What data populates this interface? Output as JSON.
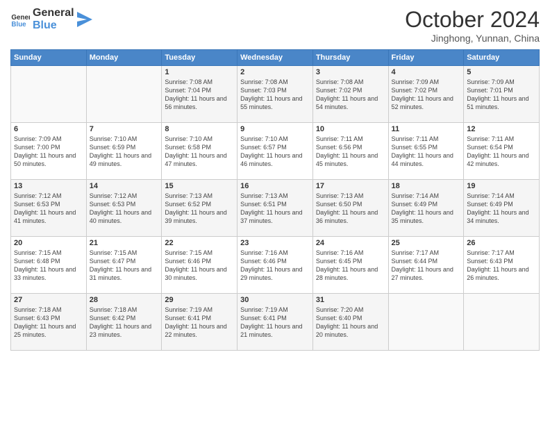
{
  "logo": {
    "line1": "General",
    "line2": "Blue"
  },
  "title": "October 2024",
  "location": "Jinghong, Yunnan, China",
  "weekdays": [
    "Sunday",
    "Monday",
    "Tuesday",
    "Wednesday",
    "Thursday",
    "Friday",
    "Saturday"
  ],
  "weeks": [
    [
      {
        "day": "",
        "info": ""
      },
      {
        "day": "",
        "info": ""
      },
      {
        "day": "1",
        "info": "Sunrise: 7:08 AM\nSunset: 7:04 PM\nDaylight: 11 hours and 56 minutes."
      },
      {
        "day": "2",
        "info": "Sunrise: 7:08 AM\nSunset: 7:03 PM\nDaylight: 11 hours and 55 minutes."
      },
      {
        "day": "3",
        "info": "Sunrise: 7:08 AM\nSunset: 7:02 PM\nDaylight: 11 hours and 54 minutes."
      },
      {
        "day": "4",
        "info": "Sunrise: 7:09 AM\nSunset: 7:02 PM\nDaylight: 11 hours and 52 minutes."
      },
      {
        "day": "5",
        "info": "Sunrise: 7:09 AM\nSunset: 7:01 PM\nDaylight: 11 hours and 51 minutes."
      }
    ],
    [
      {
        "day": "6",
        "info": "Sunrise: 7:09 AM\nSunset: 7:00 PM\nDaylight: 11 hours and 50 minutes."
      },
      {
        "day": "7",
        "info": "Sunrise: 7:10 AM\nSunset: 6:59 PM\nDaylight: 11 hours and 49 minutes."
      },
      {
        "day": "8",
        "info": "Sunrise: 7:10 AM\nSunset: 6:58 PM\nDaylight: 11 hours and 47 minutes."
      },
      {
        "day": "9",
        "info": "Sunrise: 7:10 AM\nSunset: 6:57 PM\nDaylight: 11 hours and 46 minutes."
      },
      {
        "day": "10",
        "info": "Sunrise: 7:11 AM\nSunset: 6:56 PM\nDaylight: 11 hours and 45 minutes."
      },
      {
        "day": "11",
        "info": "Sunrise: 7:11 AM\nSunset: 6:55 PM\nDaylight: 11 hours and 44 minutes."
      },
      {
        "day": "12",
        "info": "Sunrise: 7:11 AM\nSunset: 6:54 PM\nDaylight: 11 hours and 42 minutes."
      }
    ],
    [
      {
        "day": "13",
        "info": "Sunrise: 7:12 AM\nSunset: 6:53 PM\nDaylight: 11 hours and 41 minutes."
      },
      {
        "day": "14",
        "info": "Sunrise: 7:12 AM\nSunset: 6:53 PM\nDaylight: 11 hours and 40 minutes."
      },
      {
        "day": "15",
        "info": "Sunrise: 7:13 AM\nSunset: 6:52 PM\nDaylight: 11 hours and 39 minutes."
      },
      {
        "day": "16",
        "info": "Sunrise: 7:13 AM\nSunset: 6:51 PM\nDaylight: 11 hours and 37 minutes."
      },
      {
        "day": "17",
        "info": "Sunrise: 7:13 AM\nSunset: 6:50 PM\nDaylight: 11 hours and 36 minutes."
      },
      {
        "day": "18",
        "info": "Sunrise: 7:14 AM\nSunset: 6:49 PM\nDaylight: 11 hours and 35 minutes."
      },
      {
        "day": "19",
        "info": "Sunrise: 7:14 AM\nSunset: 6:49 PM\nDaylight: 11 hours and 34 minutes."
      }
    ],
    [
      {
        "day": "20",
        "info": "Sunrise: 7:15 AM\nSunset: 6:48 PM\nDaylight: 11 hours and 33 minutes."
      },
      {
        "day": "21",
        "info": "Sunrise: 7:15 AM\nSunset: 6:47 PM\nDaylight: 11 hours and 31 minutes."
      },
      {
        "day": "22",
        "info": "Sunrise: 7:15 AM\nSunset: 6:46 PM\nDaylight: 11 hours and 30 minutes."
      },
      {
        "day": "23",
        "info": "Sunrise: 7:16 AM\nSunset: 6:46 PM\nDaylight: 11 hours and 29 minutes."
      },
      {
        "day": "24",
        "info": "Sunrise: 7:16 AM\nSunset: 6:45 PM\nDaylight: 11 hours and 28 minutes."
      },
      {
        "day": "25",
        "info": "Sunrise: 7:17 AM\nSunset: 6:44 PM\nDaylight: 11 hours and 27 minutes."
      },
      {
        "day": "26",
        "info": "Sunrise: 7:17 AM\nSunset: 6:43 PM\nDaylight: 11 hours and 26 minutes."
      }
    ],
    [
      {
        "day": "27",
        "info": "Sunrise: 7:18 AM\nSunset: 6:43 PM\nDaylight: 11 hours and 25 minutes."
      },
      {
        "day": "28",
        "info": "Sunrise: 7:18 AM\nSunset: 6:42 PM\nDaylight: 11 hours and 23 minutes."
      },
      {
        "day": "29",
        "info": "Sunrise: 7:19 AM\nSunset: 6:41 PM\nDaylight: 11 hours and 22 minutes."
      },
      {
        "day": "30",
        "info": "Sunrise: 7:19 AM\nSunset: 6:41 PM\nDaylight: 11 hours and 21 minutes."
      },
      {
        "day": "31",
        "info": "Sunrise: 7:20 AM\nSunset: 6:40 PM\nDaylight: 11 hours and 20 minutes."
      },
      {
        "day": "",
        "info": ""
      },
      {
        "day": "",
        "info": ""
      }
    ]
  ]
}
